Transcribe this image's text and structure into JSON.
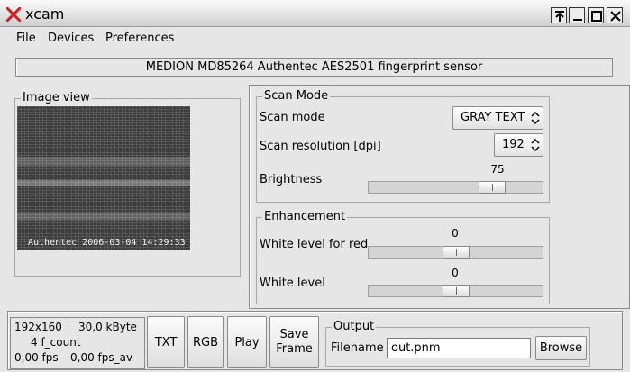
{
  "window": {
    "title": "xcam"
  },
  "menu": [
    "File",
    "Devices",
    "Preferences"
  ],
  "device": {
    "name": "MEDION MD85264 Authentec AES2501 fingerprint sensor"
  },
  "image_view": {
    "title": "Image view",
    "caption": "Authentec 2006-03-04 14:29:33"
  },
  "scan_mode_group": {
    "title": "Scan Mode",
    "scan_mode_label": "Scan mode",
    "scan_mode_value": "GRAY TEXT",
    "resolution_label": "Scan resolution [dpi]",
    "resolution_value": "192",
    "brightness_label": "Brightness",
    "brightness_value": "75",
    "brightness_fraction": 0.75
  },
  "enhancement_group": {
    "title": "Enhancement",
    "white_red_label": "White level for red",
    "white_red_value": "0",
    "white_red_fraction": 0.5,
    "white_label": "White level",
    "white_value": "0",
    "white_fraction": 0.5
  },
  "stats": {
    "size": "192x160",
    "kbyte": "30,0 kByte",
    "count": "4 f_count",
    "fps": "0,00 fps",
    "fps_av": "0,00 fps_av"
  },
  "buttons": {
    "txt": "TXT",
    "rgb": "RGB",
    "play": "Play",
    "save_line1": "Save",
    "save_line2": "Frame"
  },
  "output": {
    "title": "Output",
    "filename_label": "Filename",
    "filename_value": "out.pnm",
    "browse": "Browse"
  }
}
